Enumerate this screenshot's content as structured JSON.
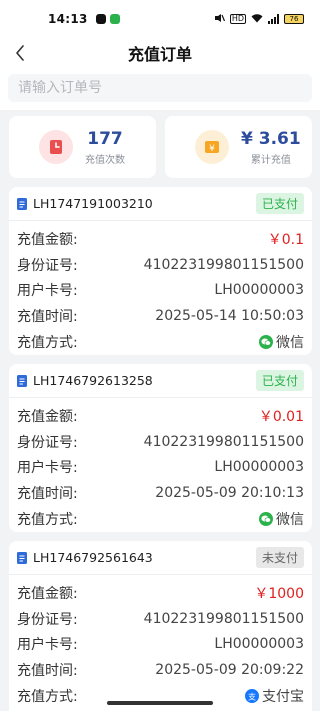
{
  "status_bar": {
    "time": "14:13",
    "battery": "76"
  },
  "header": {
    "title": "充值订单"
  },
  "search": {
    "placeholder": "请输入订单号"
  },
  "stats": [
    {
      "value": "177",
      "label": "充值次数",
      "icon": "history-icon",
      "color": "#ea4f4f"
    },
    {
      "value": "¥ 3.61",
      "label": "累计充值",
      "icon": "yuan-icon",
      "color": "#f5a623"
    }
  ],
  "field_labels": {
    "amount": "充值金额:",
    "id_card": "身份证号:",
    "card_no": "用户卡号:",
    "time": "充值时间:",
    "method": "充值方式:"
  },
  "orders": [
    {
      "order_no": "LH1747191003210",
      "status": "已支付",
      "amount": "￥0.1",
      "id_card": "410223199801151500",
      "card_no": "LH00000003",
      "time": "2025-05-14 10:50:03",
      "method": "微信"
    },
    {
      "order_no": "LH1746792613258",
      "status": "已支付",
      "amount": "￥0.01",
      "id_card": "410223199801151500",
      "card_no": "LH00000003",
      "time": "2025-05-09 20:10:13",
      "method": "微信"
    },
    {
      "order_no": "LH1746792561643",
      "status": "未支付",
      "amount": "￥1000",
      "id_card": "410223199801151500",
      "card_no": "LH00000003",
      "time": "2025-05-09 20:09:22",
      "method": "支付宝"
    }
  ],
  "colors": {
    "paid": "#2bb24c",
    "unpaid": "#666666",
    "amount": "#e02020",
    "wechat": "#2bb24c",
    "alipay": "#1677ff"
  }
}
